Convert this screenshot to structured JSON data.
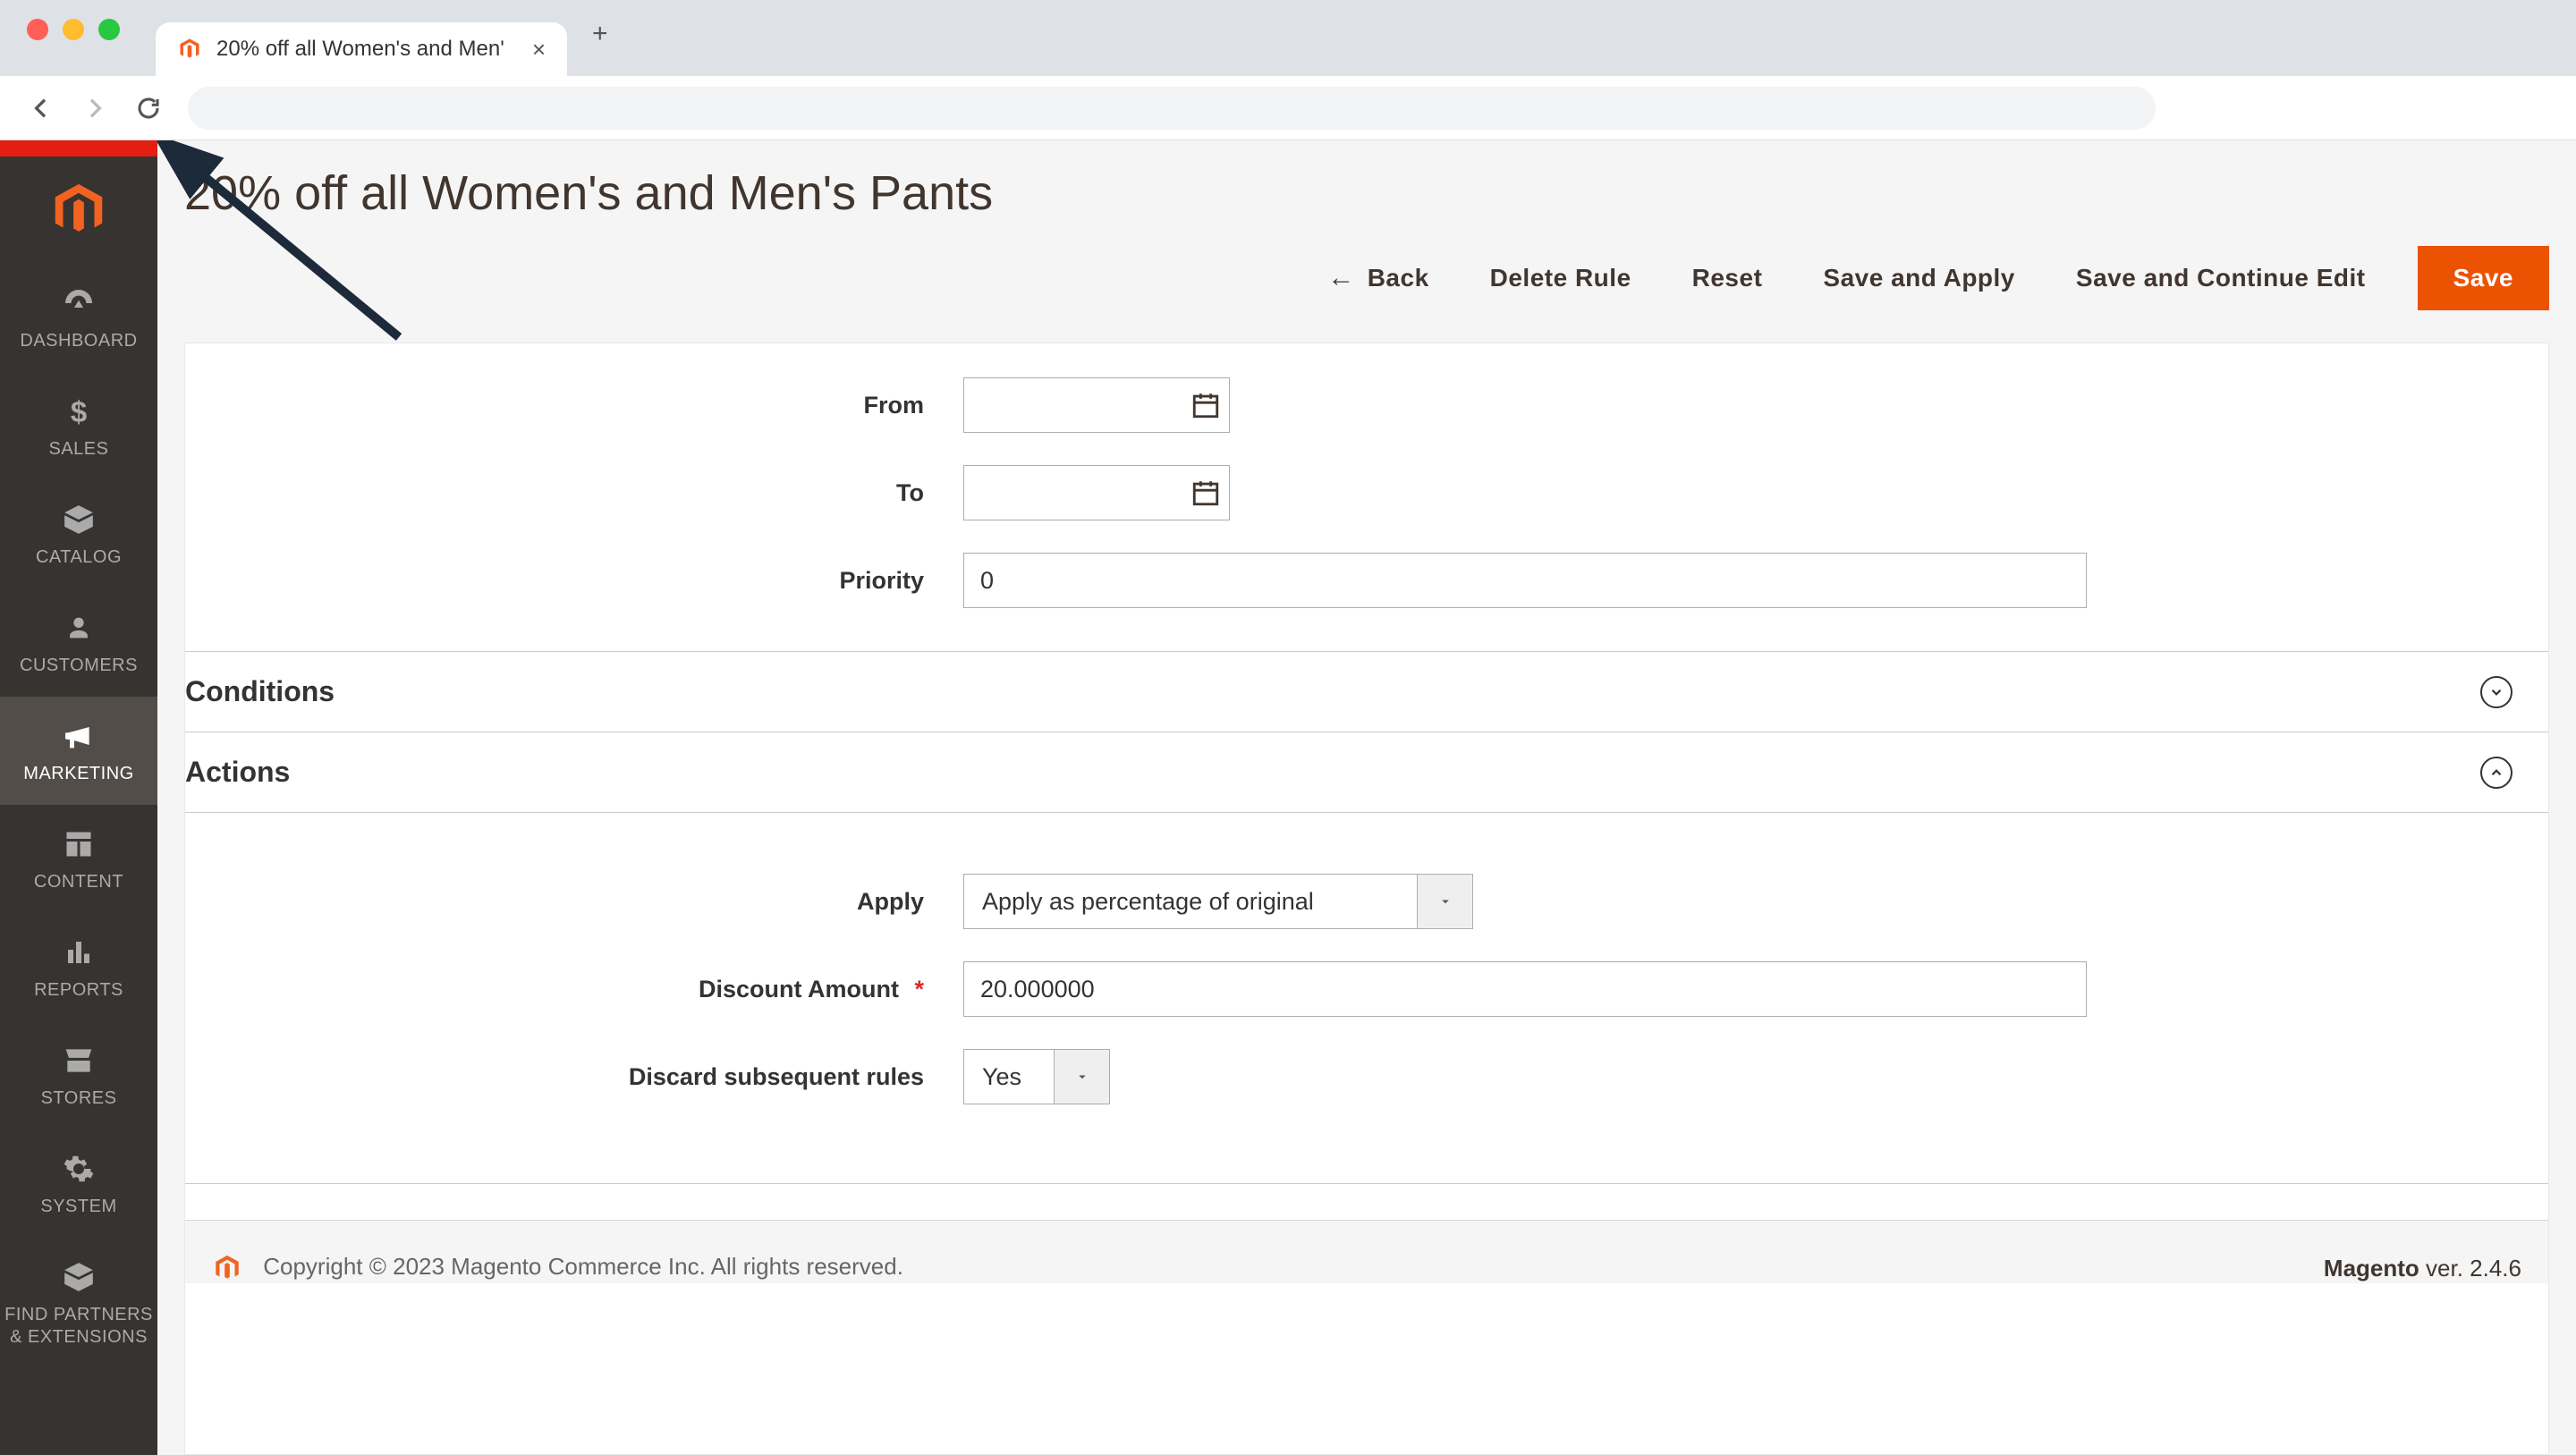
{
  "browser": {
    "tab_title": "20% off all Women's and Men'",
    "tab_close": "×",
    "new_tab": "+"
  },
  "page": {
    "title": "20% off all Women's and Men's Pants"
  },
  "buttons": {
    "back": "Back",
    "delete": "Delete Rule",
    "reset": "Reset",
    "save_apply": "Save and Apply",
    "save_continue": "Save and Continue Edit",
    "save": "Save"
  },
  "sidebar": {
    "items": [
      {
        "label": "DASHBOARD"
      },
      {
        "label": "SALES"
      },
      {
        "label": "CATALOG"
      },
      {
        "label": "CUSTOMERS"
      },
      {
        "label": "MARKETING"
      },
      {
        "label": "CONTENT"
      },
      {
        "label": "REPORTS"
      },
      {
        "label": "STORES"
      },
      {
        "label": "SYSTEM"
      },
      {
        "label": "FIND PARTNERS & EXTENSIONS"
      }
    ]
  },
  "form": {
    "from": {
      "label": "From",
      "value": ""
    },
    "to": {
      "label": "To",
      "value": ""
    },
    "priority": {
      "label": "Priority",
      "value": "0"
    }
  },
  "sections": {
    "conditions": "Conditions",
    "actions": "Actions"
  },
  "actions_form": {
    "apply": {
      "label": "Apply",
      "value": "Apply as percentage of original"
    },
    "discount_amount": {
      "label": "Discount Amount",
      "value": "20.000000"
    },
    "discard": {
      "label": "Discard subsequent rules",
      "value": "Yes"
    }
  },
  "footer": {
    "copyright": "Copyright © 2023 Magento Commerce Inc. All rights reserved.",
    "version_label": "Magento",
    "version_text": " ver. 2.4.6"
  }
}
